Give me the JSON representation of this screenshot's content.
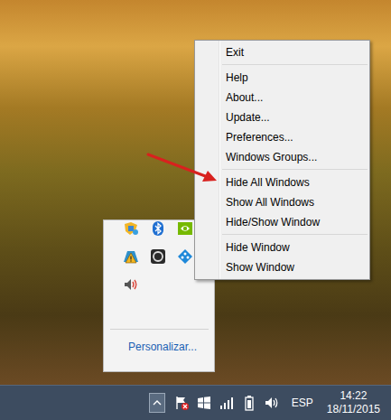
{
  "desktop": {
    "context_menu": {
      "items": [
        {
          "kind": "item",
          "label": "Exit"
        },
        {
          "kind": "separator"
        },
        {
          "kind": "item",
          "label": "Help"
        },
        {
          "kind": "item",
          "label": "About..."
        },
        {
          "kind": "item",
          "label": "Update..."
        },
        {
          "kind": "item",
          "label": "Preferences..."
        },
        {
          "kind": "item",
          "label": "Windows Groups..."
        },
        {
          "kind": "separator"
        },
        {
          "kind": "item",
          "label": "Hide All Windows"
        },
        {
          "kind": "item",
          "label": "Show All Windows"
        },
        {
          "kind": "item",
          "label": "Hide/Show Window"
        },
        {
          "kind": "separator"
        },
        {
          "kind": "item",
          "label": "Hide Window"
        },
        {
          "kind": "item",
          "label": "Show Window"
        }
      ]
    },
    "tray_overflow": {
      "link": "Personalizar..."
    }
  },
  "taskbar": {
    "language": "ESP",
    "time": "14:22",
    "date": "18/11/2015"
  }
}
